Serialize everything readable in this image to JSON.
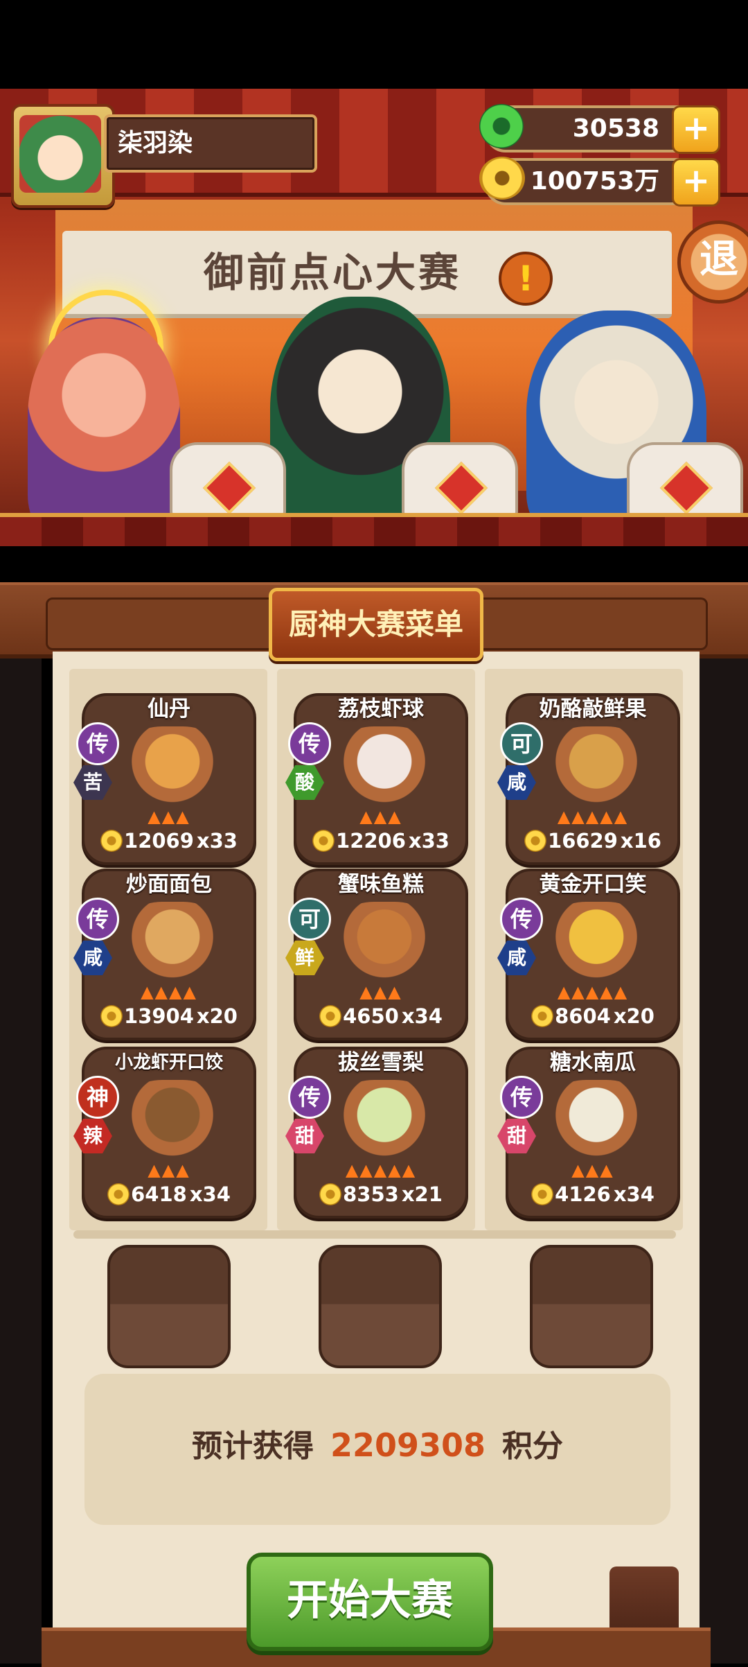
{
  "player": {
    "name": "柒羽染"
  },
  "resources": [
    {
      "icon": "jade-icon",
      "value": "30538"
    },
    {
      "icon": "coin-icon",
      "value": "100753万"
    }
  ],
  "stage": {
    "banner": "御前点心大赛",
    "exit_label": "退"
  },
  "menu": {
    "title": "厨神大赛菜单",
    "dishes": [
      {
        "name": "仙丹",
        "rarity": "传",
        "flavor": "苦",
        "flames": 3,
        "price": "12069",
        "qty": "x33"
      },
      {
        "name": "荔枝虾球",
        "rarity": "传",
        "flavor": "酸",
        "flames": 3,
        "price": "12206",
        "qty": "x33"
      },
      {
        "name": "奶酪敲鲜果",
        "rarity": "可",
        "flavor": "咸",
        "flames": 5,
        "price": "16629",
        "qty": "x16"
      },
      {
        "name": "炒面面包",
        "rarity": "传",
        "flavor": "咸",
        "flames": 4,
        "price": "13904",
        "qty": "x20"
      },
      {
        "name": "蟹味鱼糕",
        "rarity": "可",
        "flavor": "鲜",
        "flames": 3,
        "price": "4650",
        "qty": "x34"
      },
      {
        "name": "黄金开口笑",
        "rarity": "传",
        "flavor": "咸",
        "flames": 5,
        "price": "8604",
        "qty": "x20"
      },
      {
        "name": "小龙虾开口饺",
        "rarity": "神",
        "flavor": "辣",
        "flames": 3,
        "price": "6418",
        "qty": "x34"
      },
      {
        "name": "拔丝雪梨",
        "rarity": "传",
        "flavor": "甜",
        "flames": 5,
        "price": "8353",
        "qty": "x21"
      },
      {
        "name": "糖水南瓜",
        "rarity": "传",
        "flavor": "甜",
        "flames": 3,
        "price": "4126",
        "qty": "x34"
      }
    ]
  },
  "estimate": {
    "prefix": "预计获得",
    "value": "2209308",
    "suffix": "积分"
  },
  "start_button": "开始大赛",
  "colors": {
    "rarity_传": "#7a3b9a",
    "rarity_可": "#2f6e6a",
    "rarity_神": "#c0301e",
    "flavor_苦": "#3c3550",
    "flavor_酸": "#3f9a2c",
    "flavor_咸": "#1f3f8a",
    "flavor_鲜": "#c9a81c",
    "flavor_辣": "#c42a24",
    "flavor_甜": "#d8466a",
    "accent_score": "#d0501a"
  }
}
